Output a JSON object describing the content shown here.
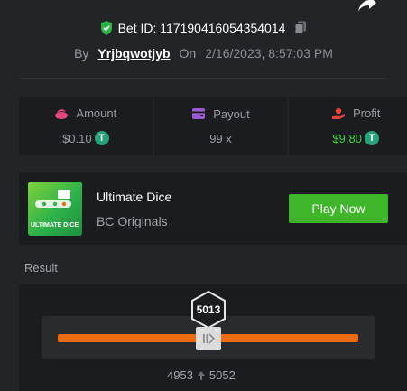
{
  "bet": {
    "label": "Bet ID: 117190416054354014"
  },
  "byline": {
    "by": "By",
    "user": "Yrjbqwotjyb",
    "on": "On",
    "date": "2/16/2023, 8:57:03 PM"
  },
  "stats": {
    "amount": {
      "label": "Amount",
      "value": "$0.10"
    },
    "payout": {
      "label": "Payout",
      "value": "99 x"
    },
    "profit": {
      "label": "Profit",
      "value": "$9.80"
    }
  },
  "game": {
    "title": "Ultimate Dice",
    "provider": "BC Originals",
    "thumb_text": "ULTIMATE DICE",
    "play_label": "Play Now"
  },
  "result": {
    "label": "Result",
    "roll": "5013",
    "range_low": "4953",
    "range_high": "5052",
    "roll_fraction": 0.5013
  },
  "colors": {
    "background": "#232427",
    "panel": "#1b1c1f",
    "accent_green": "#3fb52a",
    "profit_green": "#3ed03e",
    "bar_orange": "#ee6b10",
    "coin_teal": "#26a17b",
    "amount_icon": "#e0457b",
    "payout_icon": "#9d5bd2",
    "profit_icon": "#e8423b"
  },
  "icons": {
    "verified": "shield-check-icon",
    "copy": "copy-icon",
    "share": "share-arrow-icon",
    "amount": "bet-chips-icon",
    "payout": "wallet-icon",
    "profit": "hand-coin-icon",
    "coin": "tether-coin-icon",
    "handle": "slider-grip-icon",
    "range": "arrow-up-icon"
  }
}
